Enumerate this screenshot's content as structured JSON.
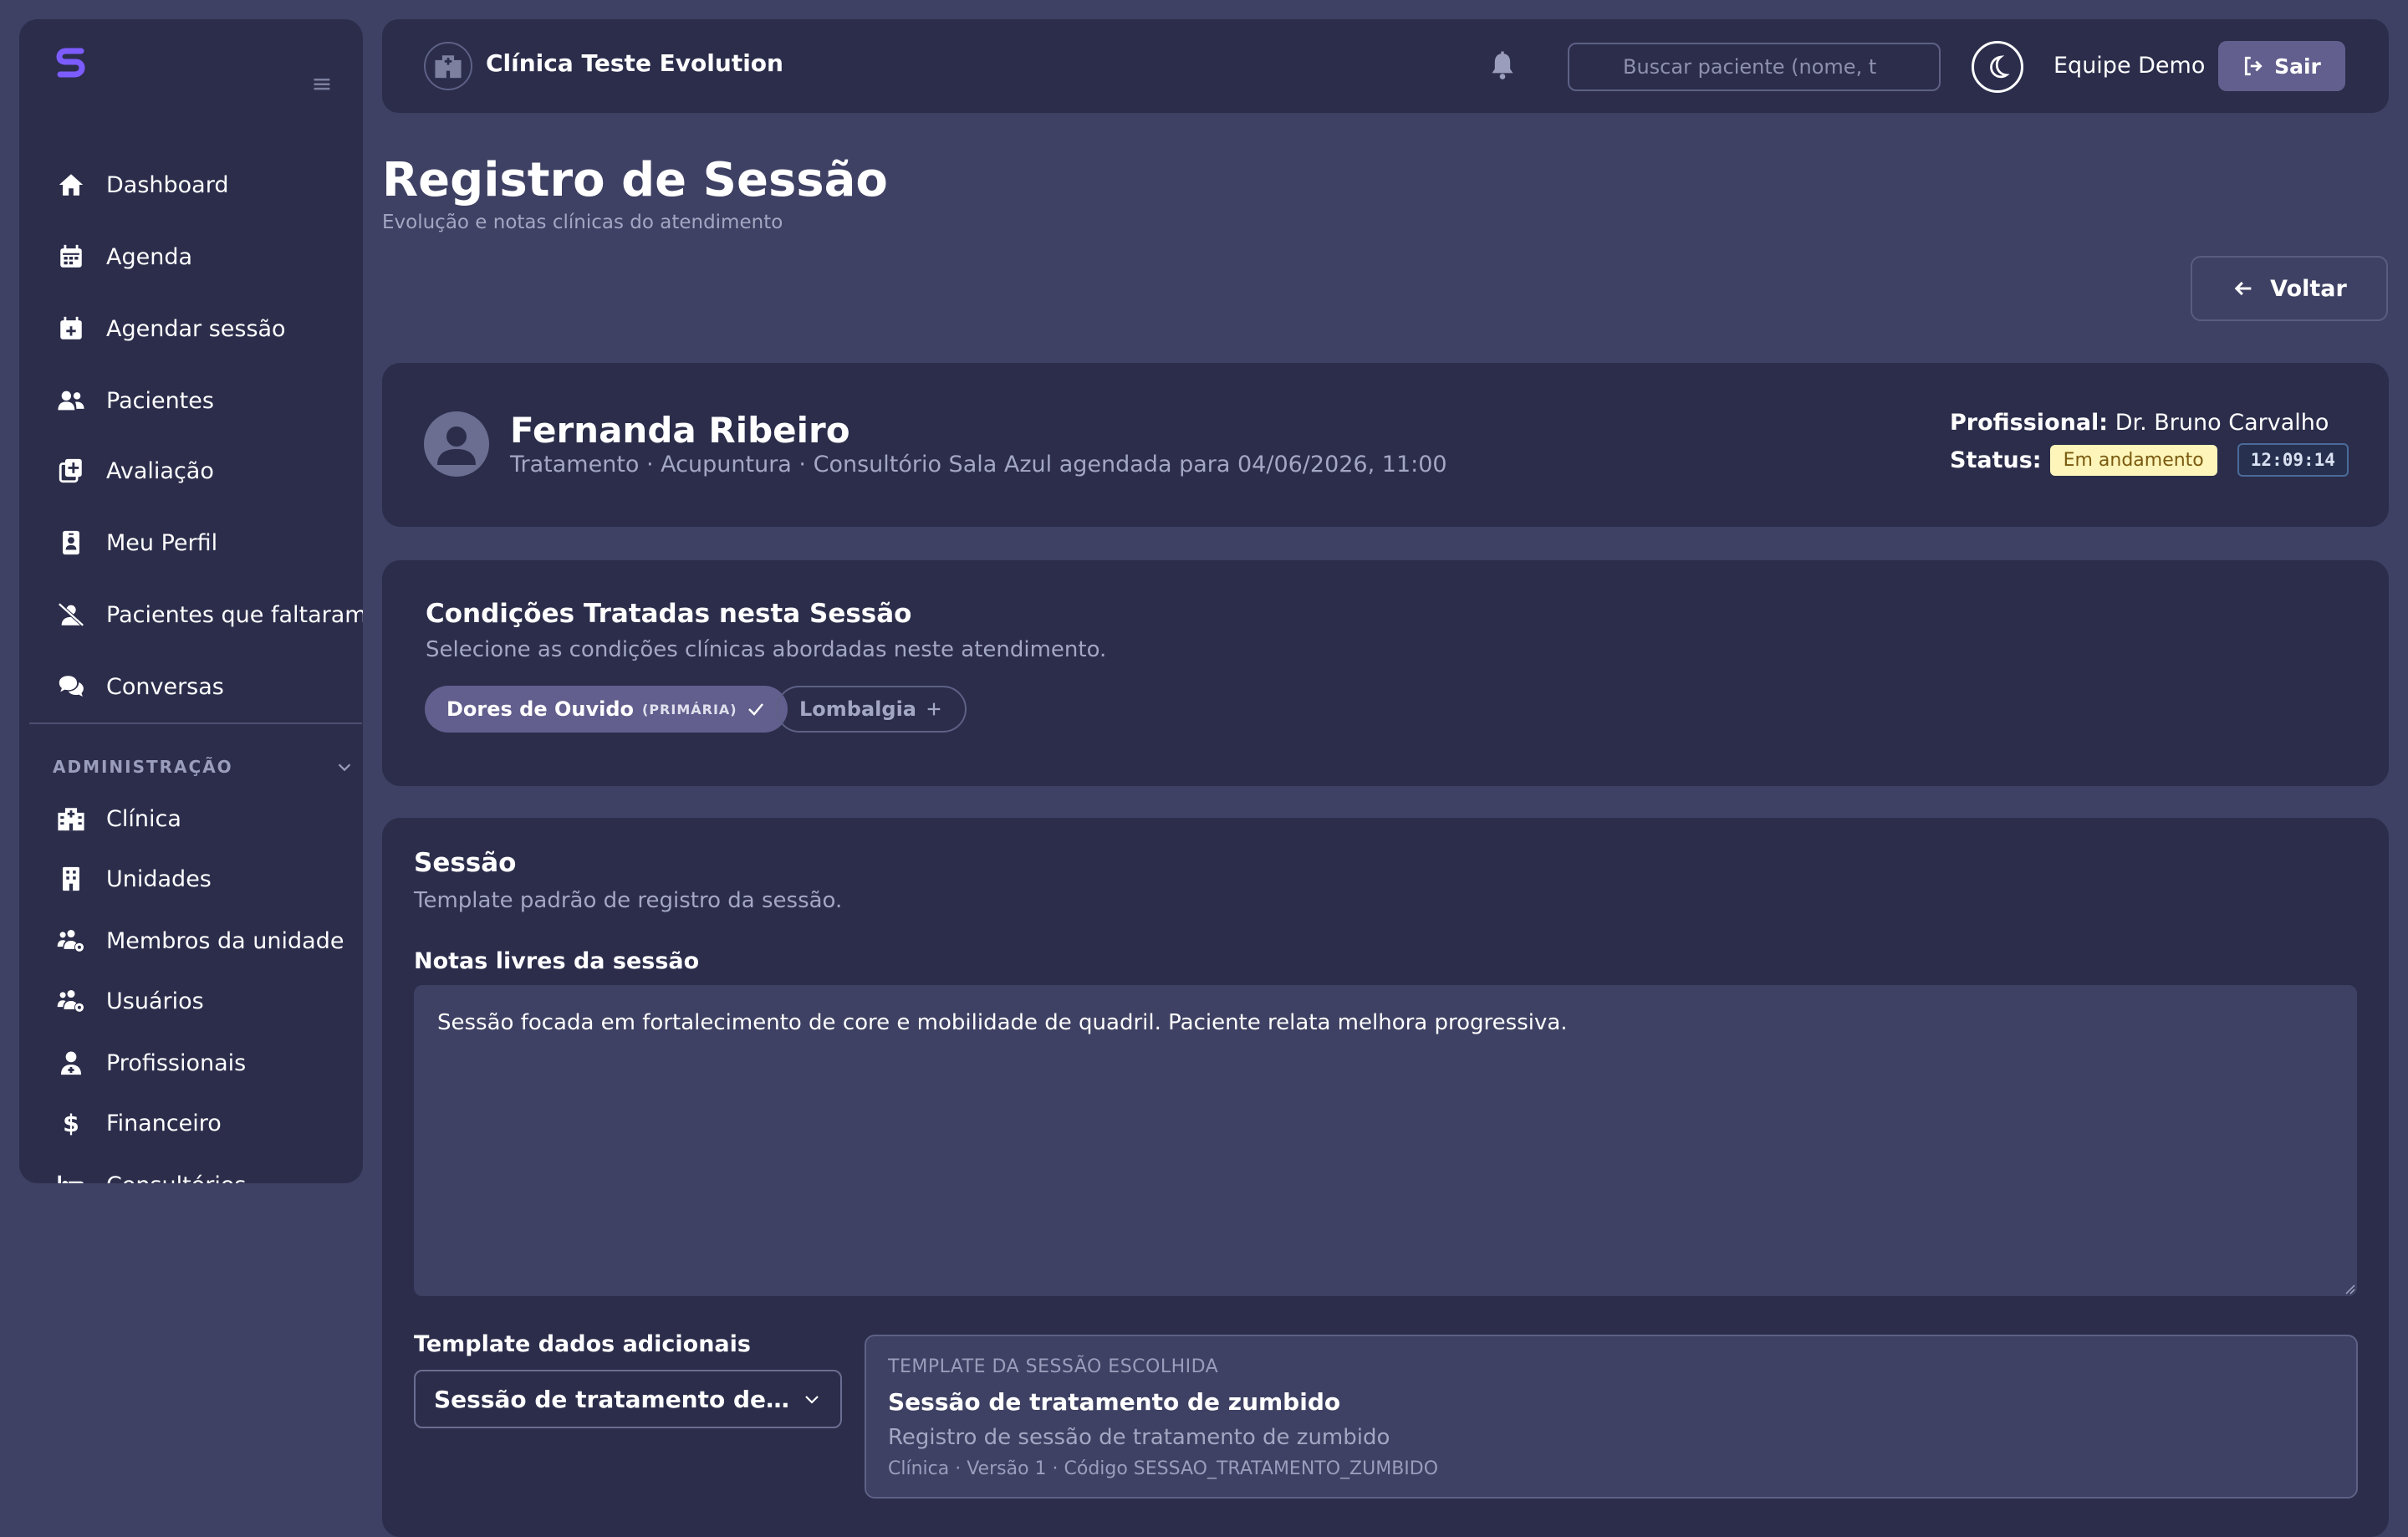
{
  "sidebar": {
    "items": [
      {
        "label": "Dashboard",
        "icon": "home-icon"
      },
      {
        "label": "Agenda",
        "icon": "calendar-icon"
      },
      {
        "label": "Agendar sessão",
        "icon": "calendar-plus-icon"
      },
      {
        "label": "Pacientes",
        "icon": "users-icon"
      },
      {
        "label": "Avaliação",
        "icon": "clipboard-plus-icon"
      },
      {
        "label": "Meu Perfil",
        "icon": "id-badge-icon"
      },
      {
        "label": "Pacientes que faltaram",
        "icon": "user-slash-icon"
      },
      {
        "label": "Conversas",
        "icon": "comments-icon"
      }
    ],
    "admin_section": {
      "label": "ADMINISTRAÇÃO",
      "items": [
        {
          "label": "Clínica",
          "icon": "hospital-icon"
        },
        {
          "label": "Unidades",
          "icon": "building-icon"
        },
        {
          "label": "Membros da unidade",
          "icon": "users-gear-icon"
        },
        {
          "label": "Usuários",
          "icon": "users-gear-icon"
        },
        {
          "label": "Profissionais",
          "icon": "user-doctor-icon"
        },
        {
          "label": "Financeiro",
          "icon": "dollar-icon"
        },
        {
          "label": "Consultórios",
          "icon": "bed-icon"
        }
      ]
    }
  },
  "topbar": {
    "clinic_name": "Clínica Teste Evolution",
    "search_placeholder": "Buscar paciente (nome, t",
    "user_name": "Equipe Demo",
    "logout_label": "Sair"
  },
  "header": {
    "title": "Registro de Sessão",
    "subtitle": "Evolução e notas clínicas do atendimento",
    "back_label": "Voltar"
  },
  "patient": {
    "name": "Fernanda Ribeiro",
    "meta": "Tratamento · Acupuntura · Consultório Sala Azul agendada para 04/06/2026, 11:00",
    "professional_label": "Profissional:",
    "professional_name": "Dr. Bruno Carvalho",
    "status_label": "Status:",
    "status_value": "Em andamento",
    "timer": "12:09:14"
  },
  "conditions": {
    "title": "Condições Tratadas nesta Sessão",
    "description": "Selecione as condições clínicas abordadas neste atendimento.",
    "chips": [
      {
        "label": "Dores de Ouvido",
        "tag": "(PRIMÁRIA)",
        "selected": true
      },
      {
        "label": "Lombalgia",
        "tag": "",
        "selected": false
      }
    ]
  },
  "session": {
    "title": "Sessão",
    "description": "Template padrão de registro da sessão.",
    "notes_label": "Notas livres da sessão",
    "notes_value": "Sessão focada em fortalecimento de core e mobilidade de quadril. Paciente relata melhora progressiva.",
    "template_label": "Template dados adicionais",
    "template_selected": "Sessão de tratamento de zumbido",
    "template_card": {
      "eyebrow": "TEMPLATE DA SESSÃO ESCOLHIDA",
      "title": "Sessão de tratamento de zumbido",
      "description": "Registro de sessão de tratamento de zumbido",
      "meta": "Clínica · Versão 1 · Código SESSAO_TRATAMENTO_ZUMBIDO"
    }
  },
  "colors": {
    "background": "#3e4163",
    "surface": "#2b2d4b",
    "accent": "#625f8e",
    "status_badge_bg": "#fdf5b9",
    "brand": "#7c5cff"
  }
}
